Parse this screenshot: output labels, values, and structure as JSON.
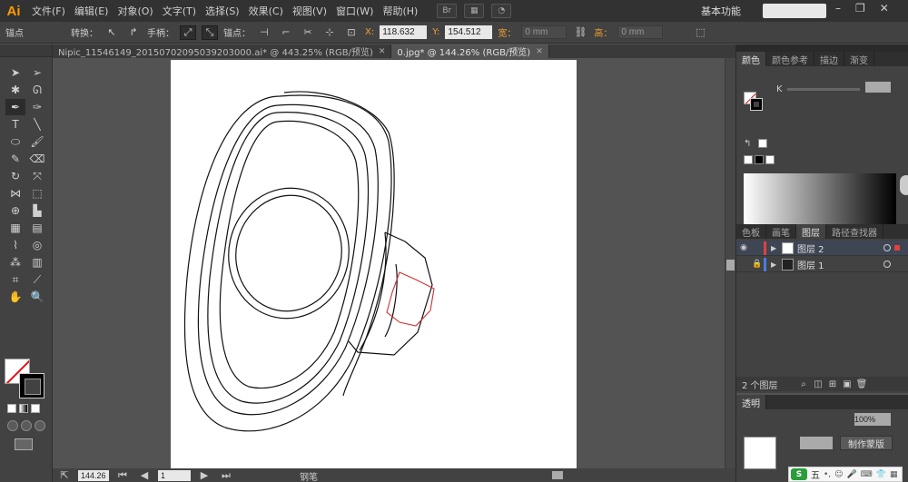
{
  "app": {
    "logo": "Ai",
    "menus": [
      "文件(F)",
      "编辑(E)",
      "对象(O)",
      "文字(T)",
      "选择(S)",
      "效果(C)",
      "视图(V)",
      "窗口(W)",
      "帮助(H)"
    ],
    "bridge_label": "Br",
    "workspace": "基本功能",
    "search_placeholder": ""
  },
  "control_bar": {
    "selection_label": "锚点",
    "convert_label": "转换：",
    "handles_label": "手柄：",
    "anchor_label": "锚点：",
    "x_label": "X:",
    "x_value": "118.632",
    "y_label": "Y:",
    "y_value": "154.512",
    "width_label": "宽：",
    "width_value": "0 mm",
    "height_label": "高：",
    "height_value": "0 mm"
  },
  "tabs": [
    {
      "label": "Nipic_11546149_20150702095039203000.ai* @ 443.25% (RGB/预览)",
      "active": false
    },
    {
      "label": "0.jpg* @ 144.26% (RGB/预览)",
      "active": true
    }
  ],
  "status_bar": {
    "zoom": "144.26",
    "page": "1",
    "tool": "钢笔"
  },
  "color_panel": {
    "tabs": [
      "颜色",
      "颜色参考",
      "描边",
      "渐变"
    ],
    "active_tab": 0,
    "k_label": "K",
    "k_value": ""
  },
  "layers_panel": {
    "tabs": [
      "色板",
      "画笔",
      "图层",
      "路径查找器"
    ],
    "active_tab": 2,
    "layers": [
      {
        "name": "图层 2",
        "color": "#e04040",
        "selected": true,
        "locked": false
      },
      {
        "name": "图层 1",
        "color": "#4a7be0",
        "selected": false,
        "locked": true
      }
    ],
    "count_label": "2 个图层"
  },
  "transparency_panel": {
    "tab": "透明",
    "opacity": "100%",
    "make_mask_label": "制作蒙版"
  },
  "ime": {
    "logo": "S",
    "mode": "五"
  },
  "colors": {
    "selected_path": "#d03030",
    "accent": "#ff9a00"
  }
}
